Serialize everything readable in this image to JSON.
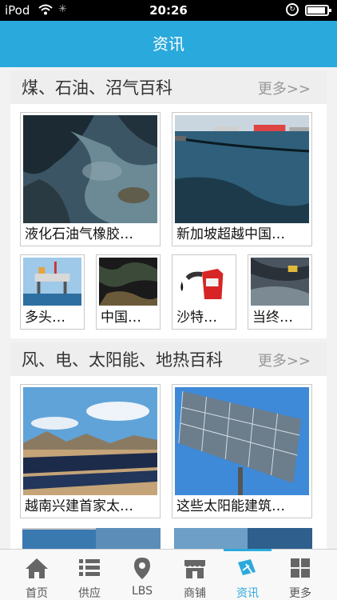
{
  "status_bar": {
    "carrier": "iPod",
    "time": "20:26"
  },
  "header": {
    "title": "资讯"
  },
  "sections": [
    {
      "title": "煤、石油、沼气百科",
      "more": "更多>>",
      "large_cards": [
        "液化石油气橡胶…",
        "新加坡超越中国…"
      ],
      "small_cards": [
        "多头…",
        "中国…",
        "沙特…",
        "当终…"
      ]
    },
    {
      "title": "风、电、太阳能、地热百科",
      "more": "更多>>",
      "large_cards": [
        "越南兴建首家太…",
        "这些太阳能建筑…"
      ]
    }
  ],
  "tabbar": {
    "items": [
      {
        "label": "首页",
        "icon": "home-icon"
      },
      {
        "label": "供应",
        "icon": "list-icon"
      },
      {
        "label": "LBS",
        "icon": "location-pin-icon"
      },
      {
        "label": "商铺",
        "icon": "store-icon"
      },
      {
        "label": "资讯",
        "icon": "news-icon",
        "active": true
      },
      {
        "label": "更多",
        "icon": "grid-icon"
      }
    ]
  },
  "colors": {
    "accent": "#2aa9dc",
    "header_text": "#ffffff"
  }
}
